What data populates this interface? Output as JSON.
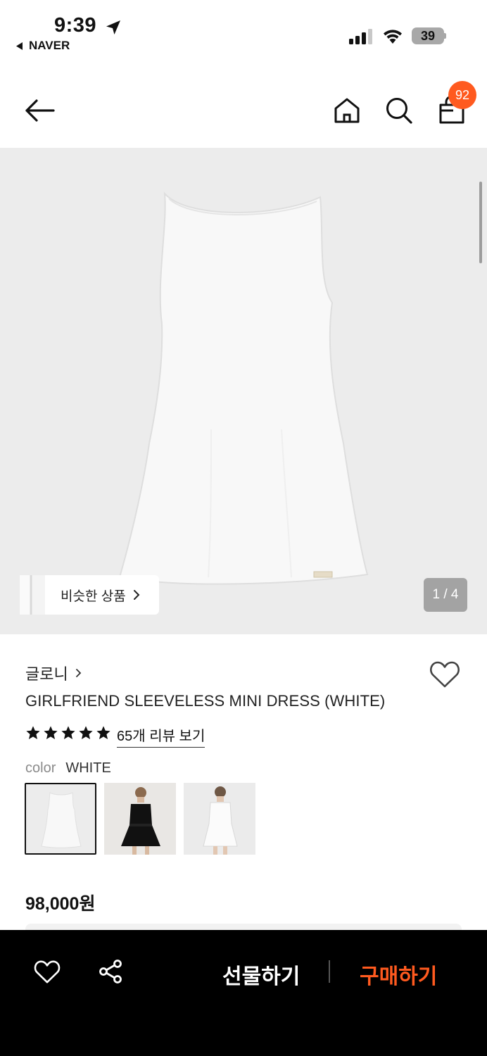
{
  "status_bar": {
    "time": "9:39",
    "back_app": "NAVER",
    "battery": "39"
  },
  "header": {
    "cart_count": "92"
  },
  "gallery": {
    "similar_label": "비슷한 상품",
    "page_indicator": "1 / 4"
  },
  "product": {
    "brand": "글로니",
    "name": "GIRLFRIEND SLEEVELESS MINI DRESS (WHITE)",
    "rating_stars": 5,
    "review_link": "65개 리뷰 보기",
    "color_label": "color",
    "color_value": "WHITE",
    "price": "98,000원"
  },
  "bottom_bar": {
    "gift_label": "선물하기",
    "buy_label": "구매하기"
  },
  "colors": {
    "accent": "#ff5a1f",
    "background": "#ececec"
  }
}
